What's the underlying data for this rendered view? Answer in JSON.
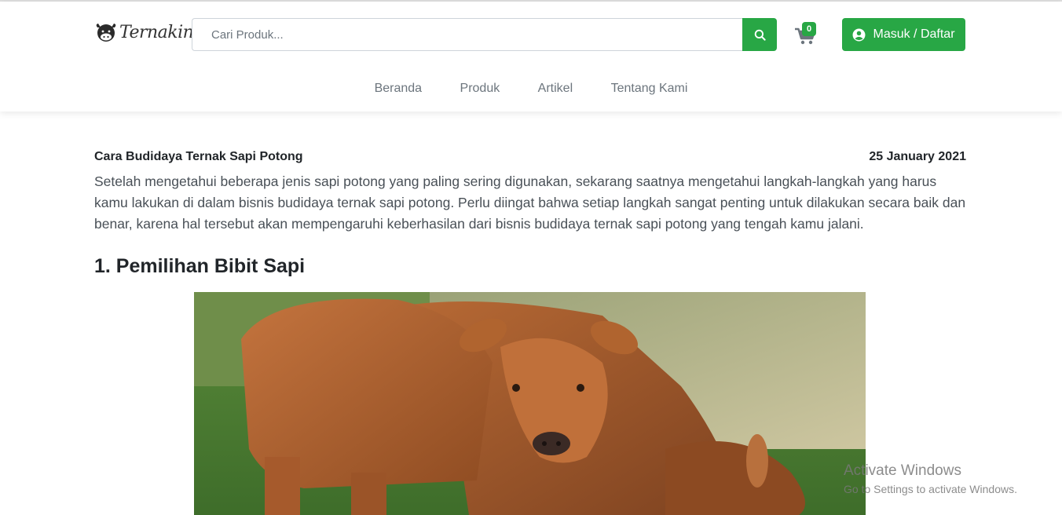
{
  "header": {
    "logo_text": "Ternakin",
    "search": {
      "placeholder": "Cari Produk..."
    },
    "cart": {
      "count": "0"
    },
    "login_label": "Masuk / Daftar"
  },
  "nav": [
    {
      "label": "Beranda"
    },
    {
      "label": "Produk"
    },
    {
      "label": "Artikel"
    },
    {
      "label": "Tentang Kami"
    }
  ],
  "article": {
    "title": "Cara Budidaya Ternak Sapi Potong",
    "date": "25 January 2021",
    "intro": "Setelah mengetahui beberapa jenis sapi potong yang paling sering digunakan, sekarang saatnya mengetahui langkah-langkah yang harus kamu lakukan di dalam bisnis budidaya ternak sapi potong. Perlu diingat bahwa setiap langkah sangat penting untuk dilakukan secara baik dan benar, karena hal tersebut akan mempengaruhi keberhasilan dari bisnis budidaya ternak sapi potong yang tengah kamu jalani.",
    "section_heading": "1. Pemilihan Bibit Sapi"
  },
  "watermark": {
    "title": "Activate Windows",
    "subtitle": "Go to Settings to activate Windows."
  },
  "colors": {
    "accent": "#28a745",
    "nav_text": "#6c757d",
    "body_text": "#495057"
  },
  "icons": {
    "logo": "cow-head-icon",
    "search": "search-icon",
    "cart": "shopping-cart-icon",
    "user": "user-circle-icon"
  }
}
